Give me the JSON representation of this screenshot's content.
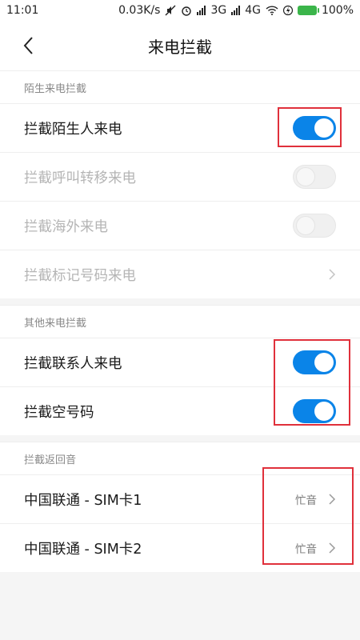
{
  "status_bar": {
    "time": "11:01",
    "speed": "0.03K/s",
    "network_1": "3G",
    "network_2": "4G",
    "battery": "100%"
  },
  "header": {
    "title": "来电拦截"
  },
  "sections": [
    {
      "header": "陌生来电拦截",
      "rows": [
        {
          "label": "拦截陌生人来电",
          "type": "toggle",
          "on": true,
          "enabled": true
        },
        {
          "label": "拦截呼叫转移来电",
          "type": "toggle",
          "on": false,
          "enabled": false
        },
        {
          "label": "拦截海外来电",
          "type": "toggle",
          "on": false,
          "enabled": false
        },
        {
          "label": "拦截标记号码来电",
          "type": "link",
          "enabled": false
        }
      ]
    },
    {
      "header": "其他来电拦截",
      "rows": [
        {
          "label": "拦截联系人来电",
          "type": "toggle",
          "on": true,
          "enabled": true
        },
        {
          "label": "拦截空号码",
          "type": "toggle",
          "on": true,
          "enabled": true
        }
      ]
    },
    {
      "header": "拦截返回音",
      "rows": [
        {
          "label": "中国联通 - SIM卡1",
          "type": "link",
          "value": "忙音",
          "enabled": true
        },
        {
          "label": "中国联通 - SIM卡2",
          "type": "link",
          "value": "忙音",
          "enabled": true
        }
      ]
    }
  ],
  "colors": {
    "accent": "#0a84e8",
    "highlight": "#e0303b"
  }
}
